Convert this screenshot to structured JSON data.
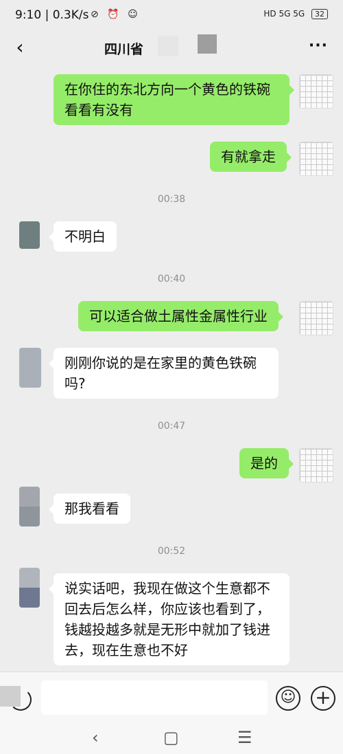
{
  "status_bar": {
    "time_speed": "9:10 | 0.3K/s",
    "icons_left": "⊘ ⏰ ☺",
    "network": "HD 5G 5G",
    "battery": "32"
  },
  "nav": {
    "back_icon": "‹",
    "title": "四川省",
    "more_icon": "···"
  },
  "messages": [
    {
      "sender": "me",
      "text": "在你住的东北方向一个黄色的铁碗看看有没有"
    },
    {
      "sender": "me",
      "text": "有就拿走"
    },
    {
      "type": "time",
      "text": "00:38"
    },
    {
      "sender": "them",
      "text": "不明白"
    },
    {
      "type": "time",
      "text": "00:40"
    },
    {
      "sender": "me",
      "text": "可以适合做土属性金属性行业"
    },
    {
      "sender": "them",
      "text": "刚刚你说的是在家里的黄色铁碗吗?"
    },
    {
      "type": "time",
      "text": "00:47"
    },
    {
      "sender": "me",
      "text": "是的"
    },
    {
      "sender": "them",
      "text": "那我看看"
    },
    {
      "type": "time",
      "text": "00:52"
    },
    {
      "sender": "them",
      "text": "说实话吧，我现在做这个生意都不回去后怎么样，你应该也看到了，钱越投越多就是无形中就加了钱进去，现在生意也不好"
    }
  ],
  "input": {
    "placeholder": ""
  },
  "icons": {
    "emoji": "☺",
    "plus": "+",
    "sys_back": "‹",
    "sys_home": "▢",
    "sys_menu": "☰"
  },
  "colors": {
    "me_bubble": "#95ec69",
    "them_bubble": "#ffffff",
    "background": "#ededed"
  }
}
